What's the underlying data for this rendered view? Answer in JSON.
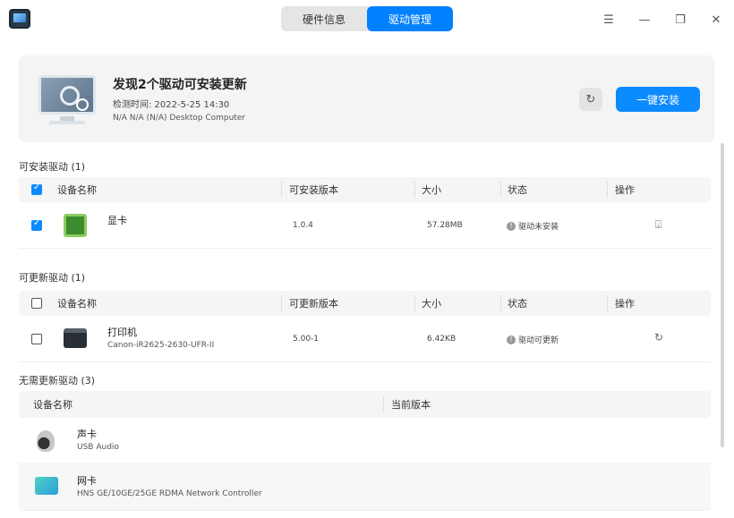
{
  "tabs": [
    {
      "label": "硬件信息",
      "active": false
    },
    {
      "label": "驱动管理",
      "active": true
    }
  ],
  "window_icons": [
    "menu-icon",
    "minimize-icon",
    "restore-icon",
    "close-icon"
  ],
  "summary": {
    "title": "发现2个驱动可安装更新",
    "time": "检测时间: 2022-5-25 14:30",
    "device": "N/A N/A (N/A) Desktop Computer",
    "install_label": "一键安装"
  },
  "installable": {
    "label": "可安装驱动 (1)",
    "headers": {
      "name": "设备名称",
      "version": "可安装版本",
      "size": "大小",
      "status": "状态",
      "action": "操作"
    },
    "rows": [
      {
        "name": "显卡",
        "subtitle": "",
        "version": "1.0.4",
        "size": "57.28MB",
        "status": "驱动未安装",
        "checked": true
      }
    ]
  },
  "updatable": {
    "label": "可更新驱动 (1)",
    "headers": {
      "name": "设备名称",
      "version": "可更新版本",
      "size": "大小",
      "status": "状态",
      "action": "操作"
    },
    "rows": [
      {
        "name": "打印机",
        "subtitle": "Canon-iR2625-2630-UFR-II",
        "version": "5.00-1",
        "size": "6.42KB",
        "status": "驱动可更新",
        "checked": false
      }
    ]
  },
  "uptodate": {
    "label": "无需更新驱动 (3)",
    "headers": {
      "name": "设备名称",
      "version": "当前版本"
    },
    "rows": [
      {
        "name": "声卡",
        "subtitle": "USB Audio"
      },
      {
        "name": "网卡",
        "subtitle": "HNS GE/10GE/25GE RDMA Network Controller"
      }
    ]
  },
  "colors": {
    "accent": "#0c8bff",
    "tab_active": "#0081ff"
  }
}
